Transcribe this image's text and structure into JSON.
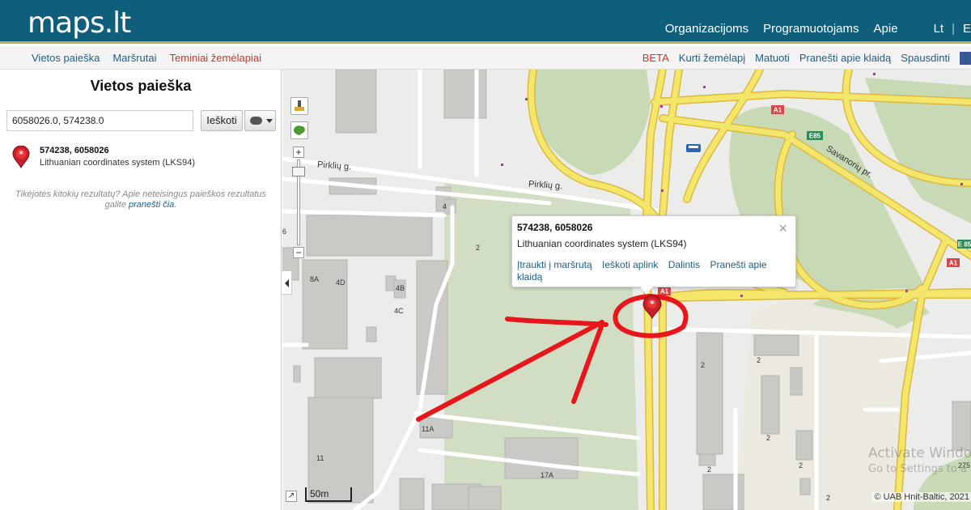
{
  "header": {
    "logo": "maps.lt",
    "nav": [
      "Organizacijoms",
      "Programuotojams",
      "Apie"
    ],
    "lang_lt": "Lt",
    "lang_sep": "|",
    "lang_en": "E"
  },
  "subnav": {
    "left": [
      "Vietos paieška",
      "Maršrutai",
      "Teminiai žemėlapiai"
    ],
    "beta": "BETA",
    "right": [
      "Kurti žemėlapį",
      "Matuoti",
      "Pranešti apie klaidą",
      "Spausdinti"
    ],
    "fb": "f"
  },
  "panel": {
    "title": "Vietos paieška",
    "search_value": "6058026.0, 574238.0",
    "search_button": "Ieškoti",
    "result_title": "574238, 6058026",
    "result_sub": "Lithuanian coordinates system (LKS94)",
    "hint_text": "Tikėjotės kitokių rezultatų? Apie neteisingus paieškos rezultatus galite",
    "hint_link": "pranešti čia",
    "hint_end": "."
  },
  "map": {
    "popup_title": "574238, 6058026",
    "popup_sub": "Lithuanian coordinates system (LKS94)",
    "popup_close": "×",
    "popup_links": [
      "Įtraukti į maršrutą",
      "Ieškoti aplink",
      "Dalintis",
      "Pranešti apie klaidą"
    ],
    "zoom_plus": "+",
    "zoom_minus": "−",
    "scale": "50m",
    "copyright": "© UAB Hnit-Baltic, 2021",
    "activate_line1": "Activate Windo",
    "activate_line2": "Go to Settings to a",
    "streets": {
      "pirkliu1": "Pirklių g.",
      "pirkliu2": "Pirklių g.",
      "savanoriu": "Savanorių pr."
    },
    "road_badges": {
      "a1_top": "A1",
      "e85_top": "E85",
      "e85_right": "E 85",
      "a1_right": "A1",
      "a1_marker": "A1"
    },
    "building_labels": [
      "4",
      "2",
      "8A",
      "4D",
      "4B",
      "4C",
      "6",
      "11A",
      "11",
      "17A",
      "2",
      "2",
      "2",
      "2",
      "2",
      "2",
      "275"
    ],
    "accent_red": "#e8161a",
    "road_yellow": "#f4e56b"
  }
}
